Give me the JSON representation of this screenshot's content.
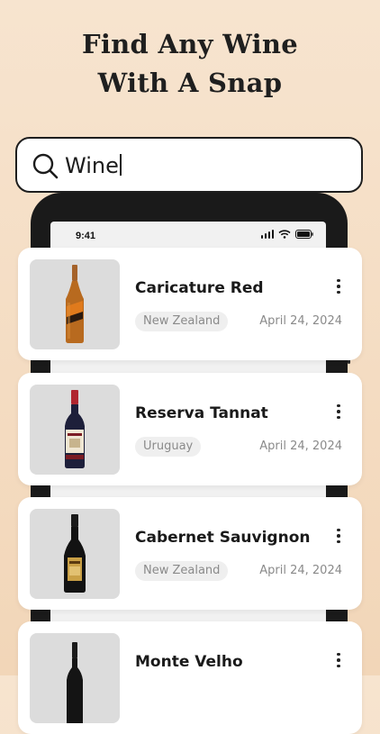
{
  "headline": {
    "line1": "Find Any Wine",
    "line2": "With A Snap"
  },
  "phone": {
    "time": "9:41"
  },
  "search": {
    "icon": "search-icon",
    "value": "Wine"
  },
  "results": [
    {
      "name": "Caricature Red",
      "country": "New Zealand",
      "date": "April 24, 2024",
      "bottle": "amber-orange-label"
    },
    {
      "name": "Reserva Tannat",
      "country": "Uruguay",
      "date": "April 24, 2024",
      "bottle": "dark-red-cream-label"
    },
    {
      "name": "Cabernet Sauvignon",
      "country": "New Zealand",
      "date": "April 24, 2024",
      "bottle": "black-gold-label"
    },
    {
      "name": "Monte Velho",
      "country": "",
      "date": "",
      "bottle": "black-bottle"
    }
  ],
  "colors": {
    "background_top": "#f7e4cf",
    "background_bottom": "#f2d6b8",
    "card": "#ffffff",
    "tag_bg": "#efefef",
    "muted_text": "#8a8a8a"
  }
}
